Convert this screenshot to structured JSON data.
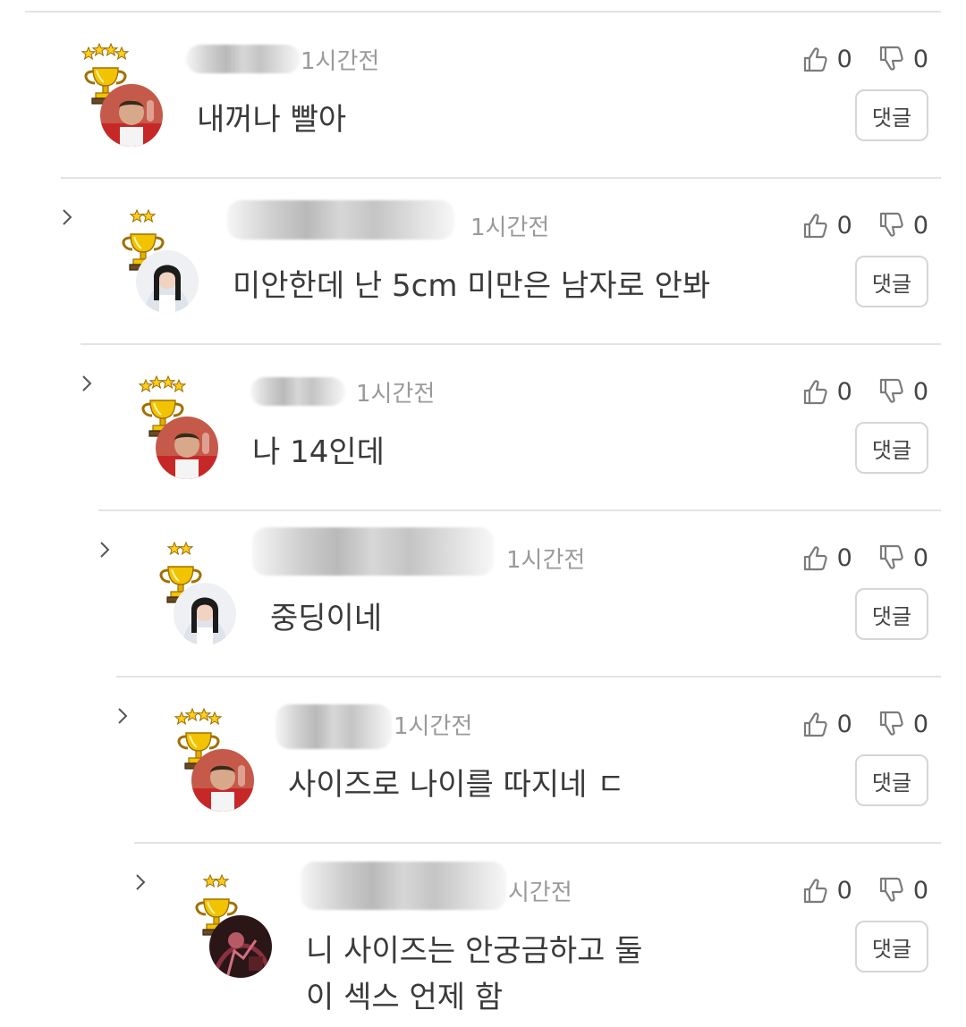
{
  "comments": [
    {
      "time": "1시간전",
      "text": "내꺼나 빨아",
      "likes": "0",
      "dislikes": "0",
      "reply": "댓글",
      "stars": 4,
      "avatar": "soccer-player"
    },
    {
      "time": "1시간전",
      "text": "미안한데 난 5cm 미만은 남자로 안봐",
      "likes": "0",
      "dislikes": "0",
      "reply": "댓글",
      "stars": 2,
      "avatar": "woman"
    },
    {
      "time": "1시간전",
      "text": "나 14인데",
      "likes": "0",
      "dislikes": "0",
      "reply": "댓글",
      "stars": 4,
      "avatar": "soccer-player"
    },
    {
      "time": "1시간전",
      "text": "중딩이네",
      "likes": "0",
      "dislikes": "0",
      "reply": "댓글",
      "stars": 2,
      "avatar": "woman"
    },
    {
      "time": "1시간전",
      "text": "사이즈로 나이를 따지네 ㄷ",
      "likes": "0",
      "dislikes": "0",
      "reply": "댓글",
      "stars": 4,
      "avatar": "soccer-player"
    },
    {
      "time": "시간전",
      "text": "니 사이즈는 안궁금하고 둘이 섹스 언제 함",
      "likes": "0",
      "dislikes": "0",
      "reply": "댓글",
      "stars": 2,
      "avatar": "dark-photo"
    }
  ],
  "colors": {
    "trophy": "#f2c300",
    "trophy_shade": "#d89b00",
    "star": "#ffcf1a",
    "text": "#3a3a3a",
    "time": "#9a9a9a"
  },
  "icons": {
    "like": "thumbs-up-icon",
    "dislike": "thumbs-down-icon",
    "expand": "chevron-right-icon"
  }
}
